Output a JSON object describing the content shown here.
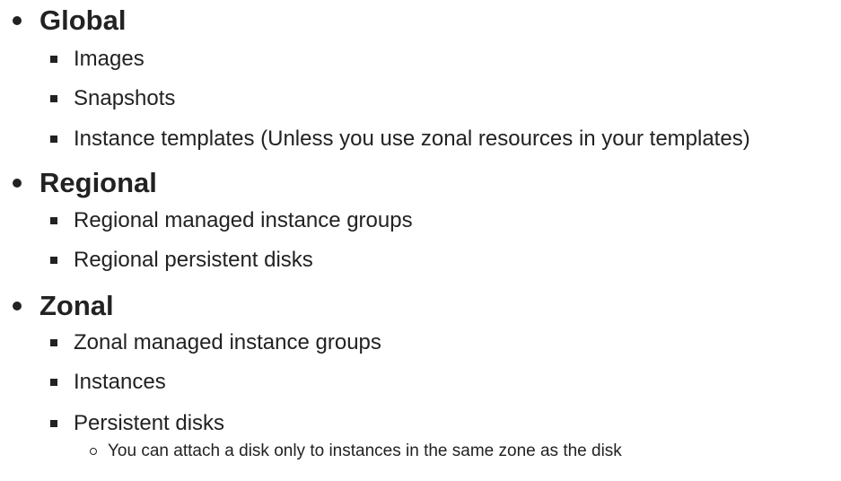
{
  "sections": [
    {
      "title": "Global",
      "items": [
        {
          "label": "Images"
        },
        {
          "label": "Snapshots"
        },
        {
          "label": "Instance templates (Unless you use zonal resources in your templates)"
        }
      ]
    },
    {
      "title": "Regional",
      "items": [
        {
          "label": "Regional managed instance groups"
        },
        {
          "label": "Regional persistent disks"
        }
      ]
    },
    {
      "title": "Zonal",
      "items": [
        {
          "label": "Zonal managed instance groups"
        },
        {
          "label": "Instances"
        },
        {
          "label": "Persistent disks",
          "subitems": [
            "You can attach a disk only to instances in the same zone as the disk"
          ]
        }
      ]
    }
  ]
}
